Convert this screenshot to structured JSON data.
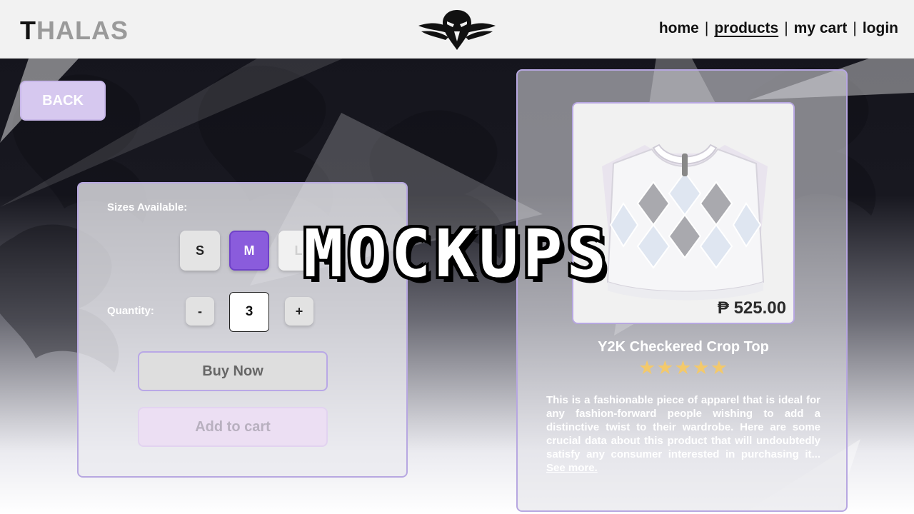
{
  "header": {
    "brand": {
      "first_letter": "T",
      "rest": "HALAS"
    },
    "logo": "eagle-logo",
    "nav": {
      "home": "home",
      "products": "products",
      "cart": "my cart",
      "login": "login",
      "separator": "|",
      "active": "products"
    }
  },
  "back_button": {
    "label": "BACK"
  },
  "options": {
    "sizes_label": "Sizes Available:",
    "sizes": [
      "S",
      "M",
      "L"
    ],
    "selected_size": "M",
    "quantity_label": "Quantity:",
    "minus_label": "-",
    "plus_label": "+",
    "quantity_value": "3",
    "buy_now_label": "Buy Now",
    "add_to_cart_label": "Add to cart"
  },
  "product": {
    "price": "₱ 525.00",
    "name": "Y2K Checkered Crop Top",
    "stars": "★★★★★",
    "rating": 5,
    "description": "This is a fashionable piece of apparel that is ideal for any fashion-forward people wishing to add a distinctive twist to their wardrobe. Here are some crucial data about this product that will undoubtedly satisfy any consumer interested in purchasing it...",
    "see_more": "See more."
  },
  "overlay_title": "MOCKUPS",
  "colors": {
    "accent": "#8a5cdc",
    "panel_border": "#b7a7e1",
    "star": "#f3c96b"
  }
}
